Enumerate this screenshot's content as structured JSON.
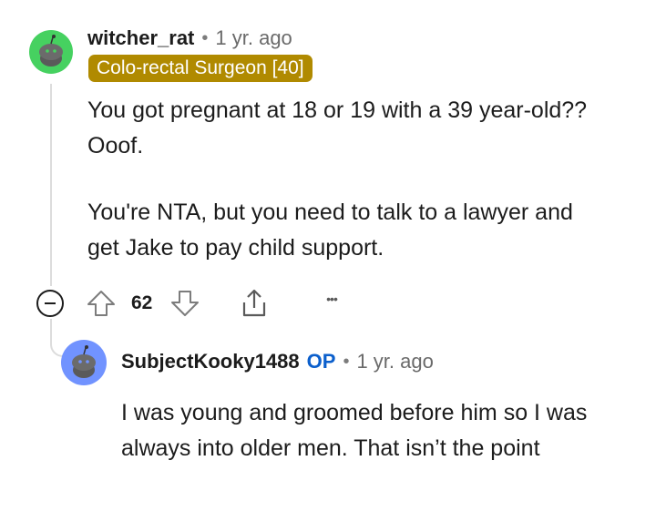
{
  "comment": {
    "username": "witcher_rat",
    "separator": "•",
    "time": "1 yr. ago",
    "flair": "Colo-rectal Surgeon [40]",
    "paragraphs": [
      "You got pregnant at 18 or 19 with a 39 year-old?? Ooof.",
      "You're NTA, but you need to talk to a lawyer and get Jake to pay child support."
    ],
    "vote_count": "62",
    "more": "•••",
    "colors": {
      "flair_bg": "#b08a00",
      "avatar_bg": "#46d160",
      "link": "#0b5fcc"
    }
  },
  "reply": {
    "username": "SubjectKooky1488",
    "op_label": "OP",
    "separator": "•",
    "time": "1 yr. ago",
    "text": "I was young and groomed before him so I was always into older men. That isn’t the point",
    "colors": {
      "avatar_bg": "#7193ff"
    }
  },
  "icons": [
    "collapse-icon",
    "upvote-icon",
    "downvote-icon",
    "share-icon",
    "more-icon",
    "snoo-avatar-icon"
  ]
}
